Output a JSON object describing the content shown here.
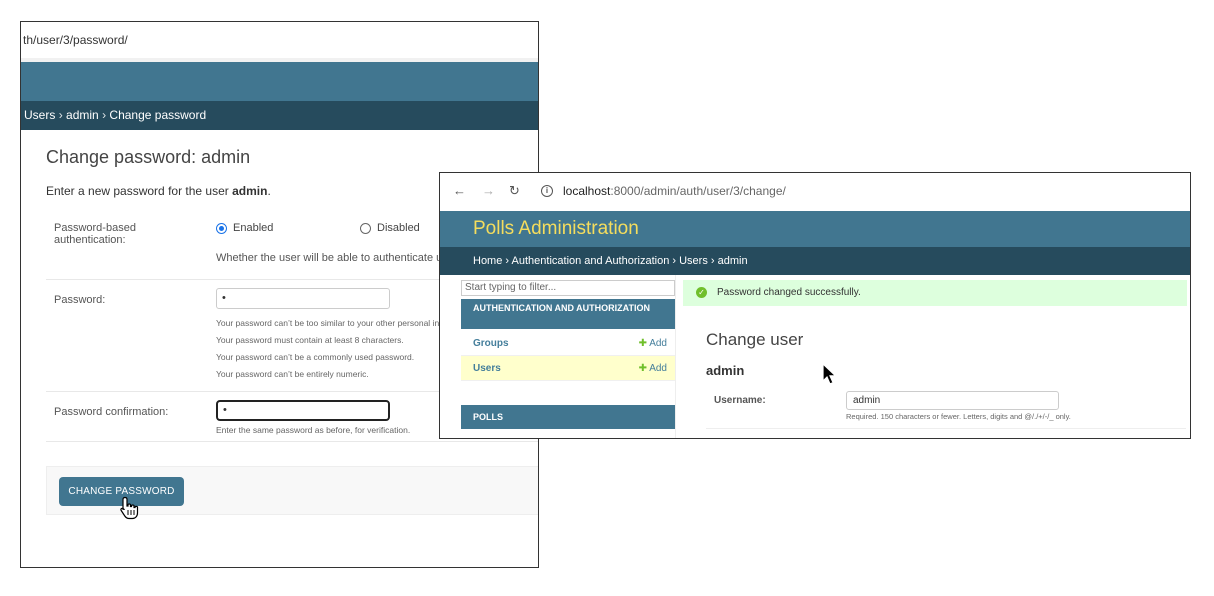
{
  "back_window": {
    "url": "th/user/3/password/",
    "breadcrumbs": [
      "Users",
      "admin",
      "Change password"
    ],
    "crumb_sep": "›",
    "title": "Change password: admin",
    "intro_prefix": "Enter a new password for the user ",
    "intro_user": "admin",
    "intro_suffix": ".",
    "auth_label": "Password-based authentication:",
    "auth_enabled": "Enabled",
    "auth_disabled": "Disabled",
    "auth_selected": "Enabled",
    "auth_help": "Whether the user will be able to authenticate using",
    "password_label": "Password:",
    "password_value": "•",
    "password_help": [
      "Your password can’t be too similar to your other personal info",
      "Your password must contain at least 8 characters.",
      "Your password can’t be a commonly used password.",
      "Your password can’t be entirely numeric."
    ],
    "confirm_label": "Password confirmation:",
    "confirm_value": "•",
    "confirm_help": "Enter the same password as before, for verification.",
    "submit_label": "CHANGE PASSWORD"
  },
  "front_window": {
    "url_host": "localhost",
    "url_path": ":8000/admin/auth/user/3/change/",
    "brand": "Polls Administration",
    "breadcrumbs": [
      "Home",
      "Authentication and Authorization",
      "Users",
      "admin"
    ],
    "crumb_sep": "›",
    "filter_placeholder": "Start typing to filter...",
    "modules": [
      {
        "name": "AUTHENTICATION AND AUTHORIZATION",
        "rows": [
          {
            "label": "Groups",
            "add": "Add",
            "selected": false
          },
          {
            "label": "Users",
            "add": "Add",
            "selected": true
          }
        ]
      },
      {
        "name": "POLLS",
        "rows": []
      }
    ],
    "message": "Password changed successfully.",
    "title": "Change user",
    "object_name": "admin",
    "username_label": "Username:",
    "username_value": "admin",
    "username_help": "Required. 150 characters or fewer. Letters, digits and @/./+/-/_ only."
  },
  "colors": {
    "header": "#417690",
    "breadcrumbs": "#264b5d",
    "brand": "#f5dd5d",
    "success_bg": "#dfd",
    "selected_row": "#ffffcc",
    "add_plus": "#70bf2b"
  }
}
